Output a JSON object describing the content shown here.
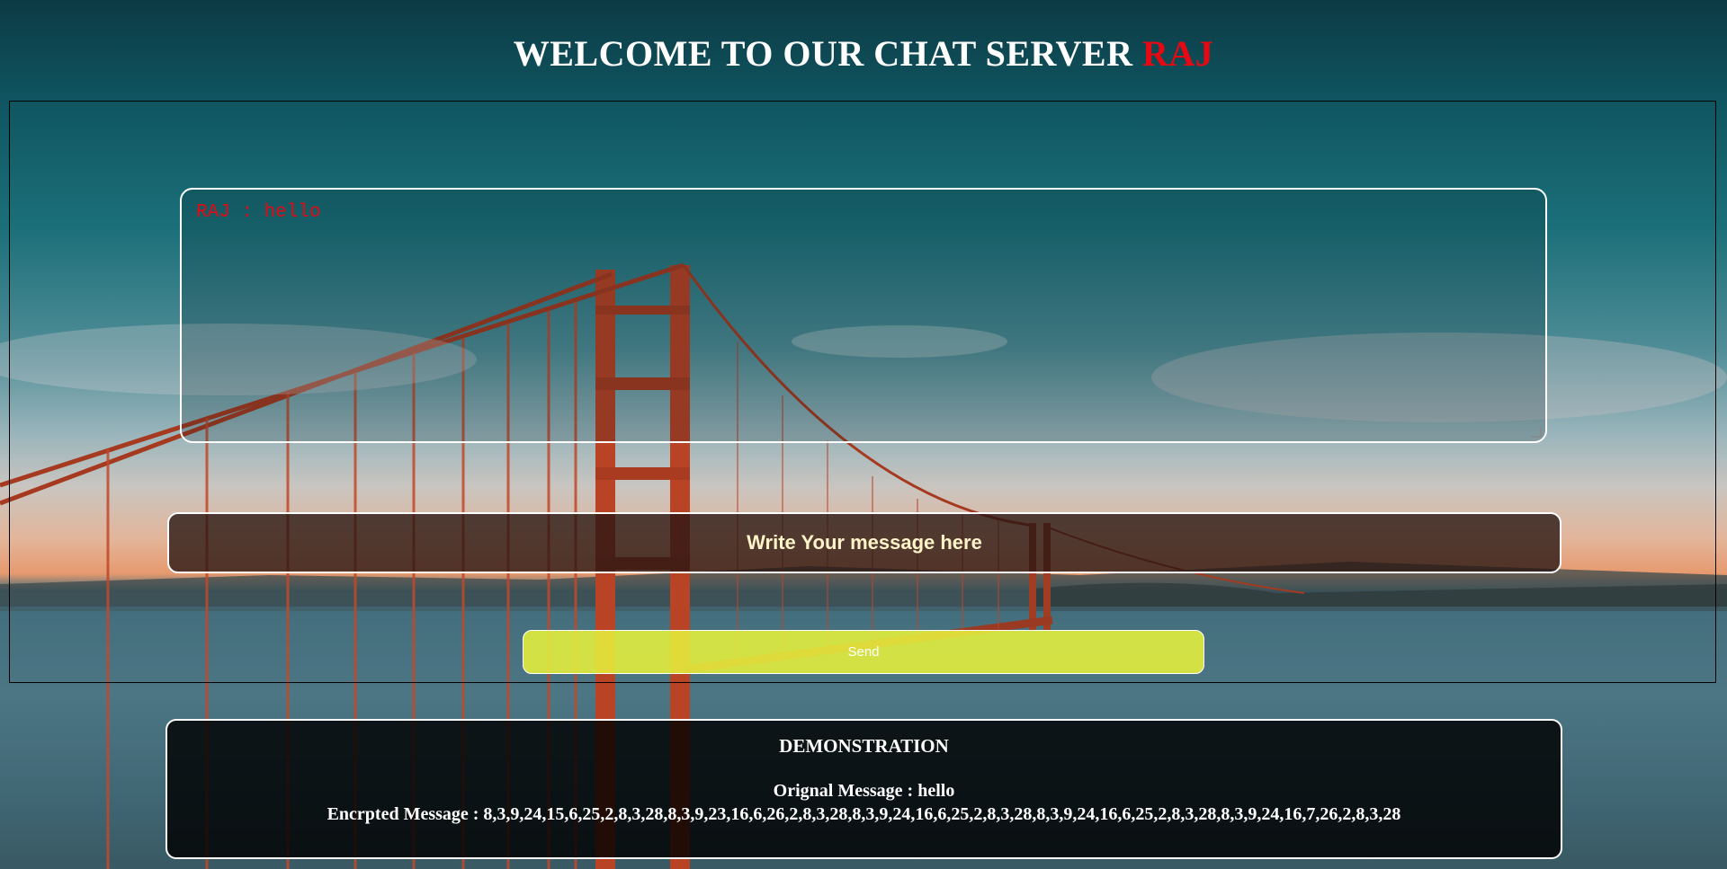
{
  "header": {
    "title": "WELCOME TO OUR CHAT SERVER",
    "username": "RAJ"
  },
  "chat": {
    "messages": [
      "RAJ : hello"
    ]
  },
  "composer": {
    "placeholder": "Write Your message here",
    "send_label": "Send"
  },
  "demo": {
    "title": "DEMONSTRATION",
    "original_label": "Orignal Message :",
    "original_value": "hello",
    "encrypted_label": "Encrpted Message :",
    "encrypted_value": "8,3,9,24,15,6,25,2,8,3,28,8,3,9,23,16,6,26,2,8,3,28,8,3,9,24,16,6,25,2,8,3,28,8,3,9,24,16,6,25,2,8,3,28,8,3,9,24,16,7,26,2,8,3,28"
  },
  "colors": {
    "accent_red": "#e50914",
    "send_button": "#e6f03c",
    "border": "#ffffff"
  }
}
